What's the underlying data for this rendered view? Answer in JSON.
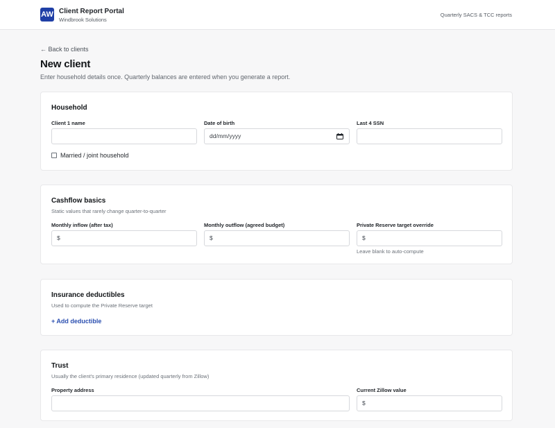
{
  "header": {
    "logo_text": "AW",
    "app_title": "Client Report Portal",
    "app_subtitle": "Windbrook Solutions",
    "right_text": "Quarterly SACS & TCC reports"
  },
  "page": {
    "back_link": "← Back to clients",
    "title": "New client",
    "description": "Enter household details once. Quarterly balances are entered when you generate a report."
  },
  "household": {
    "title": "Household",
    "client1_label": "Client 1 name",
    "dob_label": "Date of birth",
    "dob_placeholder": "dd/mm/yyyy",
    "ssn_label": "Last 4 SSN",
    "married_label": "Married / joint household"
  },
  "cashflow": {
    "title": "Cashflow basics",
    "subtitle": "Static values that rarely change quarter-to-quarter",
    "inflow_label": "Monthly inflow (after tax)",
    "outflow_label": "Monthly outflow (agreed budget)",
    "reserve_label": "Private Reserve target override",
    "currency_prefix": "$",
    "reserve_hint": "Leave blank to auto-compute"
  },
  "insurance": {
    "title": "Insurance deductibles",
    "subtitle": "Used to compute the Private Reserve target",
    "add_label": "+ Add deductible"
  },
  "trust": {
    "title": "Trust",
    "subtitle": "Usually the client's primary residence (updated quarterly from Zillow)",
    "address_label": "Property address",
    "zillow_label": "Current Zillow value",
    "currency_prefix": "$"
  },
  "colors": {
    "brand": "#1f3fa6",
    "link": "#2b4fb0"
  }
}
